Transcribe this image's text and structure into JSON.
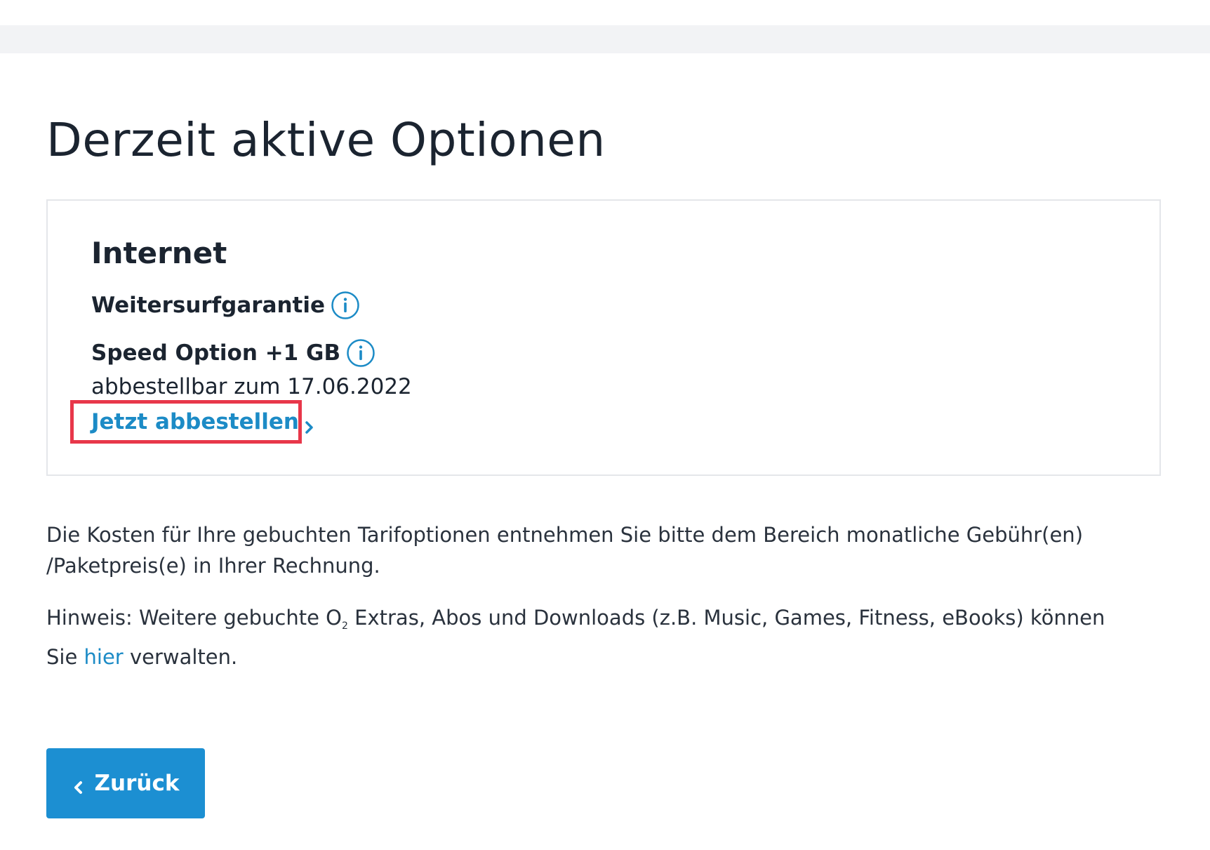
{
  "page": {
    "title": "Derzeit aktive Optionen"
  },
  "card": {
    "heading": "Internet",
    "options": [
      {
        "name": "Weitersurfgarantie"
      },
      {
        "name": "Speed Option +1 GB",
        "note": "abbestellbar zum 17.06.2022",
        "action": "Jetzt abbestellen"
      }
    ]
  },
  "info": {
    "costs_text": "Die Kosten für Ihre gebuchten Tarifoptionen entnehmen Sie bitte dem Bereich monatliche Gebühr(en) /Paketpreis(e) in Ihrer Rechnung.",
    "hint_prefix": "Hinweis: Weitere gebuchte O",
    "hint_subscript": "2",
    "hint_middle": " Extras, Abos und Downloads (z.B. Music, Games, Fitness, eBooks) können Sie ",
    "hint_link": "hier",
    "hint_suffix": " verwalten."
  },
  "footer": {
    "back_label": "Zurück"
  },
  "colors": {
    "accent": "#1c8fd2",
    "link": "#1c8bc6",
    "highlight_border": "#e8374a",
    "text": "#1b2430"
  },
  "icons": [
    "info-icon",
    "chevron-right-icon",
    "chevron-left-icon"
  ]
}
